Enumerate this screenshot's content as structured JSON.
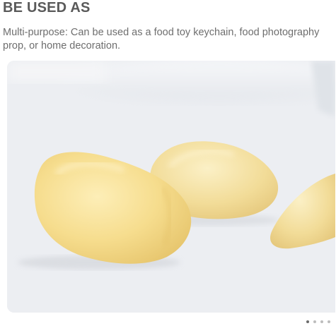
{
  "section": {
    "heading": "BE USED AS",
    "description": "Multi-purpose: Can be used as a food toy keychain, food photography prop, or home decoration."
  },
  "gallery": {
    "image_subject": "garlic cloves",
    "dots_total": 4,
    "dots_active_index": 0
  },
  "colors": {
    "heading": "#5a5a5a",
    "text": "#6e6e6e",
    "clove": "#f3d98c"
  }
}
